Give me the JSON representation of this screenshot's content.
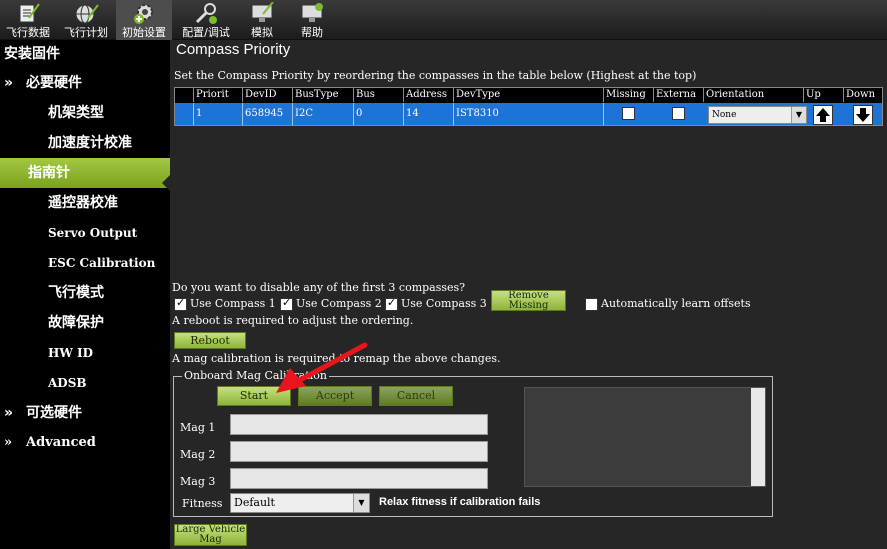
{
  "toolbar": {
    "items": [
      {
        "label": "飞行数据",
        "icon": "flight-data-icon"
      },
      {
        "label": "飞行计划",
        "icon": "flight-plan-globe-icon"
      },
      {
        "label": "初始设置",
        "icon": "initial-setup-gear-icon"
      },
      {
        "label": "配置/调试",
        "icon": "config-tuning-wrench-icon"
      },
      {
        "label": "模拟",
        "icon": "simulation-monitor-icon"
      },
      {
        "label": "帮助",
        "icon": "help-monitor-icon"
      }
    ]
  },
  "sidebar": {
    "header": "安装固件",
    "items": [
      {
        "label": "必要硬件",
        "prefix": "»"
      },
      {
        "label": "机架类型"
      },
      {
        "label": "加速度计校准"
      },
      {
        "label": "指南针"
      },
      {
        "label": "遥控器校准"
      },
      {
        "label": "Servo Output"
      },
      {
        "label": "ESC Calibration"
      },
      {
        "label": "飞行模式"
      },
      {
        "label": "故障保护"
      },
      {
        "label": "HW ID"
      },
      {
        "label": "ADSB"
      },
      {
        "label": "可选硬件",
        "prefix": "»"
      },
      {
        "label": "Advanced",
        "prefix": "»"
      }
    ]
  },
  "main": {
    "title": "Compass Priority",
    "instructions": "Set the Compass Priority by reordering the compasses in the table below (Highest at the top)",
    "table": {
      "headers": [
        "Priorit",
        "DevID",
        "BusType",
        "Bus",
        "Address",
        "DevType",
        "Missing",
        "Externa",
        "Orientation",
        "Up",
        "Down"
      ],
      "rows": [
        {
          "priority": "1",
          "devid": "658945",
          "bustype": "I2C",
          "bus": "0",
          "address": "14",
          "devtype": "IST8310",
          "missing": false,
          "external": false,
          "orientation": "None"
        }
      ]
    },
    "disable_question": "Do you want to disable any of the first 3 compasses?",
    "use_compass_1": "Use Compass 1",
    "use_compass_2": "Use Compass 2",
    "use_compass_3": "Use Compass 3",
    "use_compass_1_checked": true,
    "use_compass_2_checked": true,
    "use_compass_3_checked": true,
    "remove_missing_label": "Remove Missing",
    "auto_learn_label": "Automatically learn offsets",
    "auto_learn_checked": false,
    "reboot_note": "A reboot is required to adjust the ordering.",
    "reboot_label": "Reboot",
    "mag_cal_note": "A mag calibration is required to remap the above changes.",
    "onboard_group_label": "Onboard Mag Calibration",
    "start_label": "Start",
    "accept_label": "Accept",
    "cancel_label": "Cancel",
    "mag1_label": "Mag 1",
    "mag2_label": "Mag 2",
    "mag3_label": "Mag 3",
    "mag1_progress": 0,
    "mag2_progress": 0,
    "mag3_progress": 0,
    "fitness_label": "Fitness",
    "fitness_value": "Default",
    "relax_label": "Relax fitness if calibration fails",
    "large_vehicle_mag_label": "Large Vehicle Mag"
  },
  "colors": {
    "accent_green": "#8db43a",
    "selected_row_blue": "#1e73d6",
    "annotation_arrow": "#e8161c"
  }
}
